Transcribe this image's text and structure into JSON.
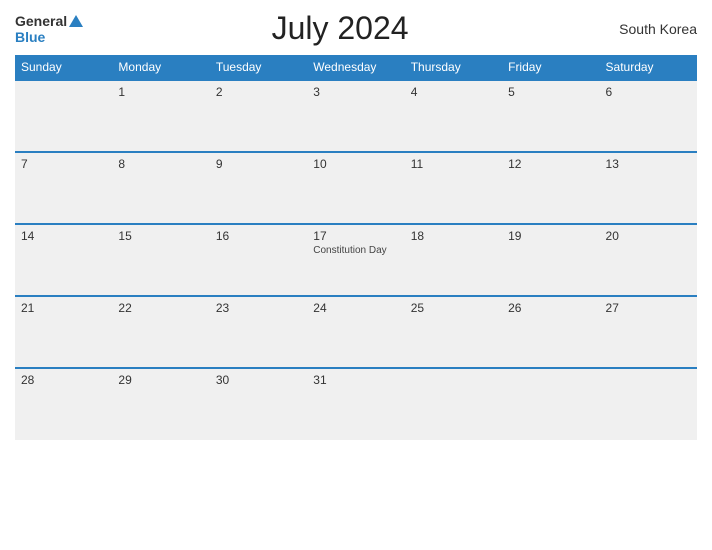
{
  "header": {
    "logo_general": "General",
    "logo_blue": "Blue",
    "title": "July 2024",
    "country": "South Korea"
  },
  "calendar": {
    "days_of_week": [
      "Sunday",
      "Monday",
      "Tuesday",
      "Wednesday",
      "Thursday",
      "Friday",
      "Saturday"
    ],
    "weeks": [
      [
        {
          "day": "",
          "event": ""
        },
        {
          "day": "1",
          "event": ""
        },
        {
          "day": "2",
          "event": ""
        },
        {
          "day": "3",
          "event": ""
        },
        {
          "day": "4",
          "event": ""
        },
        {
          "day": "5",
          "event": ""
        },
        {
          "day": "6",
          "event": ""
        }
      ],
      [
        {
          "day": "7",
          "event": ""
        },
        {
          "day": "8",
          "event": ""
        },
        {
          "day": "9",
          "event": ""
        },
        {
          "day": "10",
          "event": ""
        },
        {
          "day": "11",
          "event": ""
        },
        {
          "day": "12",
          "event": ""
        },
        {
          "day": "13",
          "event": ""
        }
      ],
      [
        {
          "day": "14",
          "event": ""
        },
        {
          "day": "15",
          "event": ""
        },
        {
          "day": "16",
          "event": ""
        },
        {
          "day": "17",
          "event": "Constitution Day"
        },
        {
          "day": "18",
          "event": ""
        },
        {
          "day": "19",
          "event": ""
        },
        {
          "day": "20",
          "event": ""
        }
      ],
      [
        {
          "day": "21",
          "event": ""
        },
        {
          "day": "22",
          "event": ""
        },
        {
          "day": "23",
          "event": ""
        },
        {
          "day": "24",
          "event": ""
        },
        {
          "day": "25",
          "event": ""
        },
        {
          "day": "26",
          "event": ""
        },
        {
          "day": "27",
          "event": ""
        }
      ],
      [
        {
          "day": "28",
          "event": ""
        },
        {
          "day": "29",
          "event": ""
        },
        {
          "day": "30",
          "event": ""
        },
        {
          "day": "31",
          "event": ""
        },
        {
          "day": "",
          "event": ""
        },
        {
          "day": "",
          "event": ""
        },
        {
          "day": "",
          "event": ""
        }
      ]
    ]
  }
}
